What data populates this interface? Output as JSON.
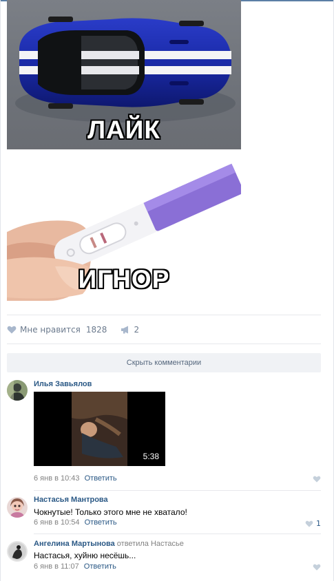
{
  "post": {
    "meme_caption_top": "ЛАЙК",
    "meme_caption_bottom": "ИГНОР",
    "likes_label": "Мне нравится",
    "likes_count": "1828",
    "shares_count": "2"
  },
  "comments_toggle": "Скрыть комментарии",
  "comments": [
    {
      "author": "Илья Завьялов",
      "video_duration": "5:38",
      "date": "6 янв в 10:43",
      "reply_label": "Ответить"
    },
    {
      "author": "Настасья Мантрова",
      "text": "Чокнутые! Только этого мне не хватало!",
      "date": "6 янв в 10:54",
      "reply_label": "Ответить",
      "likes": "1"
    },
    {
      "author": "Ангелина Мартынова",
      "reply_to": "ответила Настасье",
      "text": "Настасья, хуйню несёшь...",
      "date": "6 янв в 11:07",
      "reply_label": "Ответить"
    }
  ],
  "colors": {
    "link": "#2a5885",
    "muted": "#828282",
    "accent": "#5b7fa6"
  },
  "icons": [
    "heart-icon",
    "megaphone-icon"
  ]
}
